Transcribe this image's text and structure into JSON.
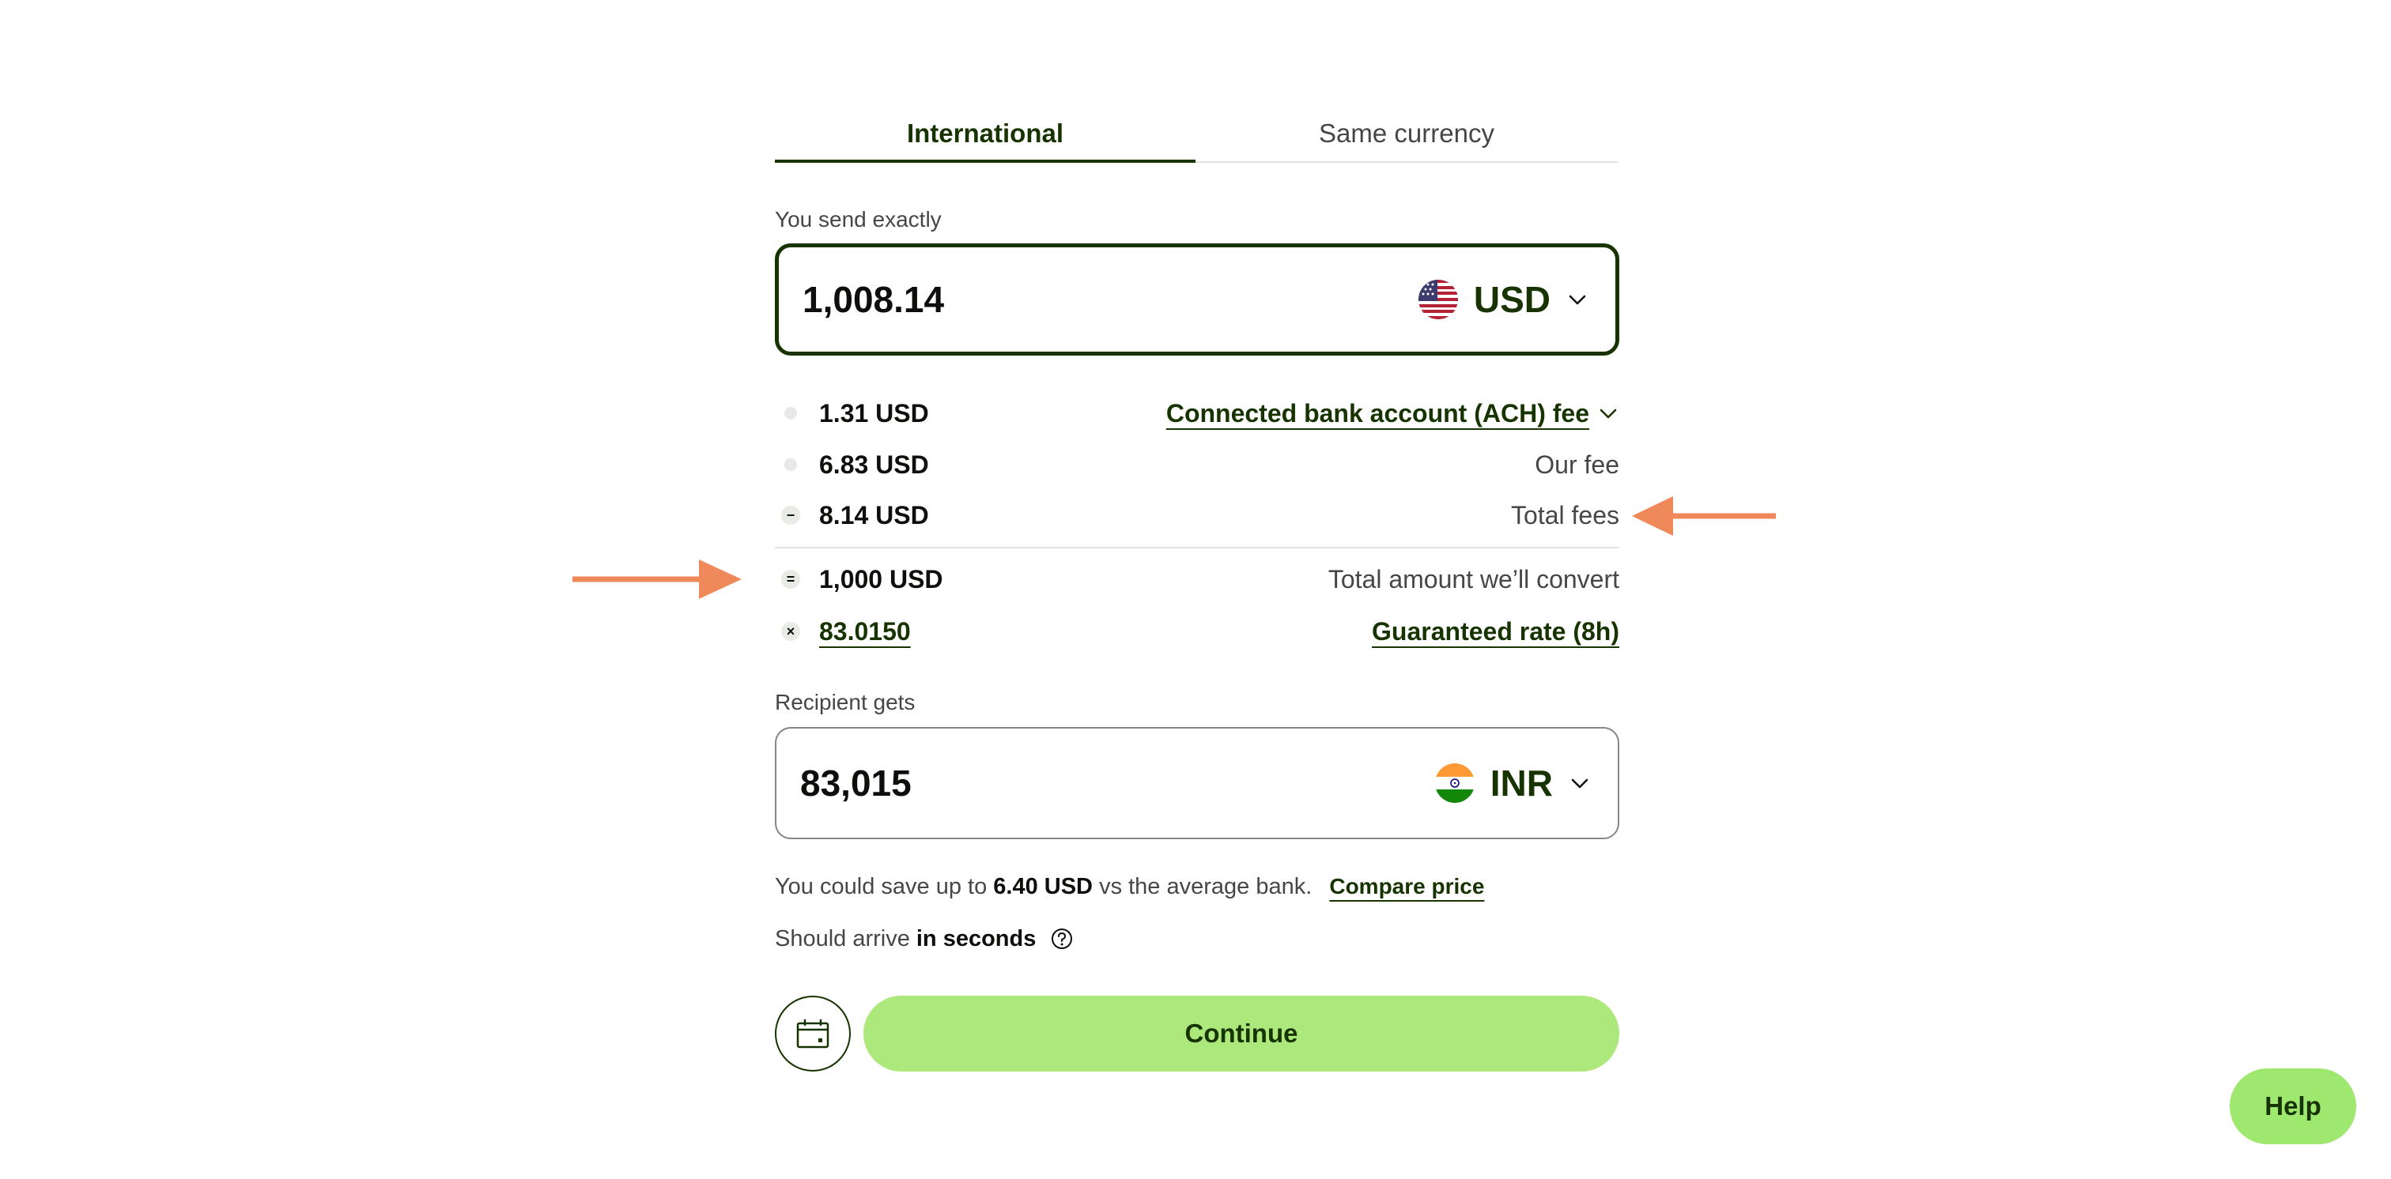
{
  "tabs": [
    {
      "label": "International",
      "active": true
    },
    {
      "label": "Same currency",
      "active": false
    }
  ],
  "send": {
    "label": "You send exactly",
    "amount": "1,008.14",
    "currency": "USD",
    "flag_icon": "us-flag-icon"
  },
  "fees": [
    {
      "bullet": "",
      "amount": "1.31 USD",
      "description": "Connected bank account (ACH) fee",
      "is_link": true,
      "has_dropdown": true
    },
    {
      "bullet": "",
      "amount": "6.83 USD",
      "description": "Our fee",
      "is_link": false
    },
    {
      "bullet": "−",
      "amount": "8.14 USD",
      "description": "Total fees",
      "is_link": false
    },
    {
      "bullet": "=",
      "amount": "1,000 USD",
      "description": "Total amount we’ll convert",
      "is_link": false
    },
    {
      "bullet": "×",
      "amount": "83.0150",
      "description": "Guaranteed rate (8h)",
      "is_link": true,
      "amount_is_link": true
    }
  ],
  "receive": {
    "label": "Recipient gets",
    "amount": "83,015",
    "currency": "INR",
    "flag_icon": "india-flag-icon"
  },
  "savings": {
    "prefix": "You could save up to",
    "amount": "6.40 USD",
    "suffix": "vs the average bank.",
    "link": "Compare price"
  },
  "arrival": {
    "prefix": "Should arrive",
    "time": "in seconds"
  },
  "actions": {
    "continue_label": "Continue",
    "schedule_icon": "calendar-icon"
  },
  "help": {
    "label": "Help"
  },
  "colors": {
    "brand_dark": "#163300",
    "brand_green": "#9fe870",
    "annotation_arrow": "#f0895a"
  }
}
